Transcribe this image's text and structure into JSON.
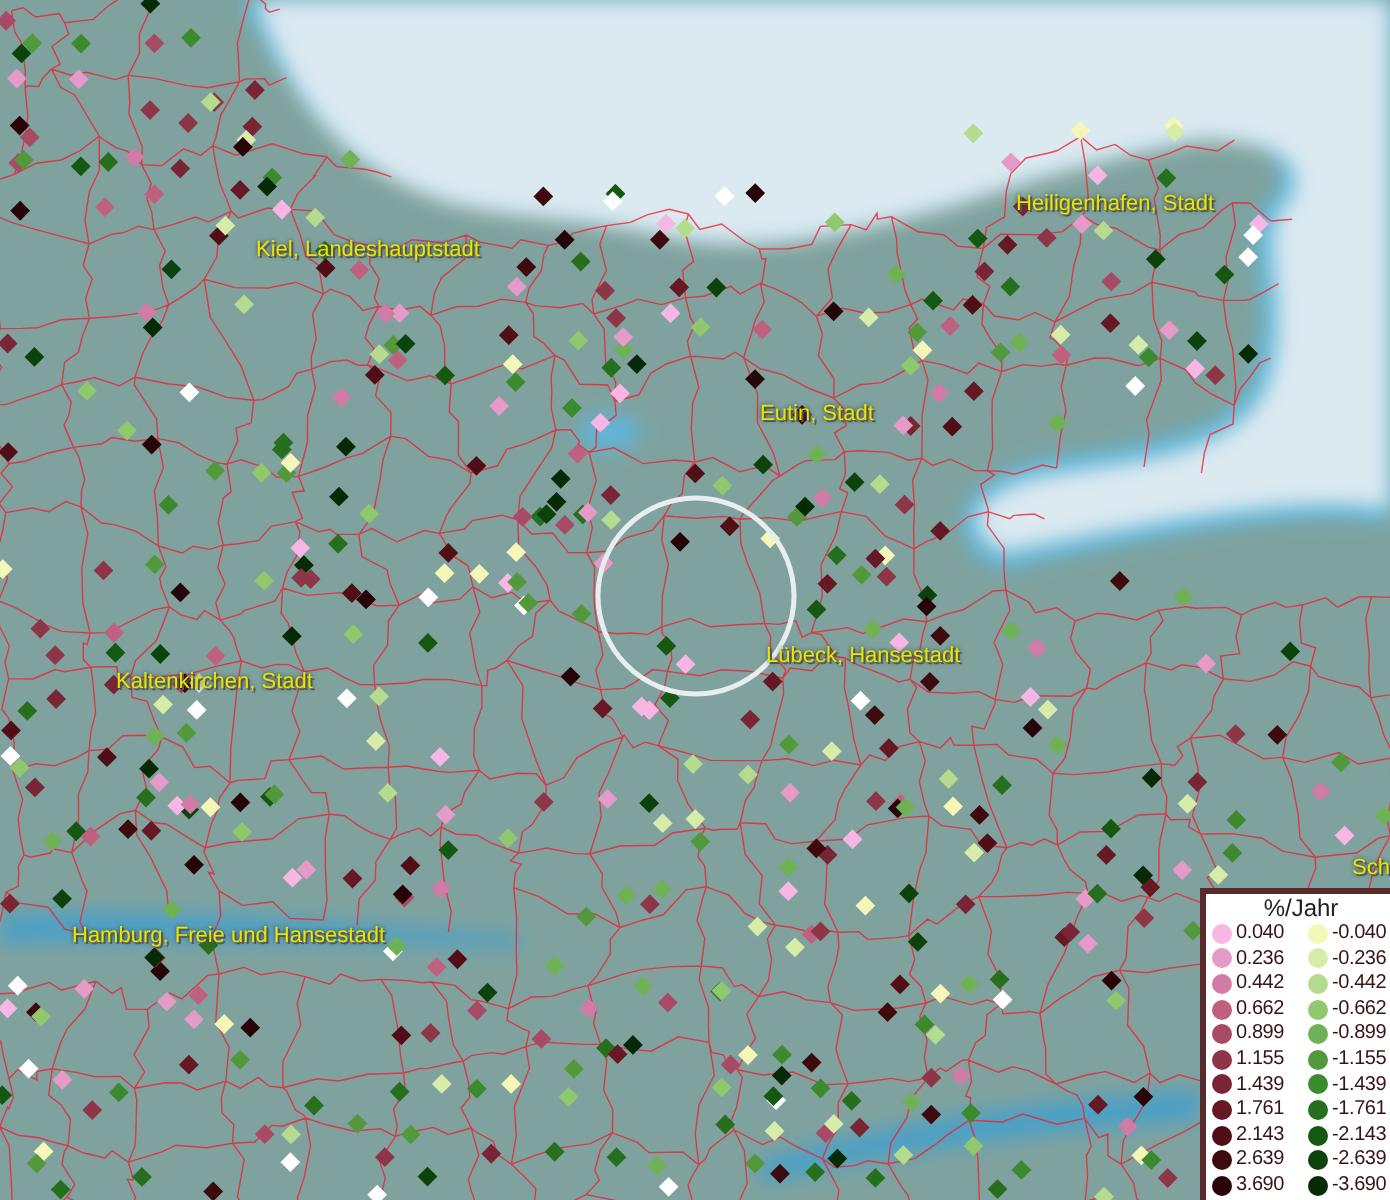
{
  "map": {
    "place_labels": [
      {
        "text": "Heiligenhafen, Stadt"
      },
      {
        "text": "Kiel, Landeshauptstadt"
      },
      {
        "text": "Eutin, Stadt"
      },
      {
        "text": "Lübeck, Hansestadt"
      },
      {
        "text": "Kaltenkirchen, Stadt"
      },
      {
        "text": "Sch"
      },
      {
        "text": "Hamburg, Freie und Hansestadt"
      }
    ]
  },
  "legend": {
    "title": "%/Jahr",
    "positive": [
      {
        "value": "0.040",
        "color": "#f7b6e4"
      },
      {
        "value": "0.236",
        "color": "#e59ac8"
      },
      {
        "value": "0.442",
        "color": "#d17ba6"
      },
      {
        "value": "0.662",
        "color": "#c0607f"
      },
      {
        "value": "0.899",
        "color": "#a84a65"
      },
      {
        "value": "1.155",
        "color": "#8e3547"
      },
      {
        "value": "1.439",
        "color": "#7a2535"
      },
      {
        "value": "1.761",
        "color": "#661824"
      },
      {
        "value": "2.143",
        "color": "#520e16"
      },
      {
        "value": "2.639",
        "color": "#3d0a0e"
      },
      {
        "value": "3.690",
        "color": "#260408"
      }
    ],
    "negative": [
      {
        "value": "-0.040",
        "color": "#f4f7b8"
      },
      {
        "value": "-0.236",
        "color": "#d8ecaa"
      },
      {
        "value": "-0.442",
        "color": "#b5db8e"
      },
      {
        "value": "-0.662",
        "color": "#90c86e"
      },
      {
        "value": "-0.899",
        "color": "#6fb155"
      },
      {
        "value": "-1.155",
        "color": "#52993c"
      },
      {
        "value": "-1.439",
        "color": "#3c8a2e"
      },
      {
        "value": "-1.761",
        "color": "#266f1d"
      },
      {
        "value": "-2.143",
        "color": "#155812"
      },
      {
        "value": "-2.639",
        "color": "#0c420c"
      },
      {
        "value": "-3.690",
        "color": "#062a06"
      }
    ]
  }
}
